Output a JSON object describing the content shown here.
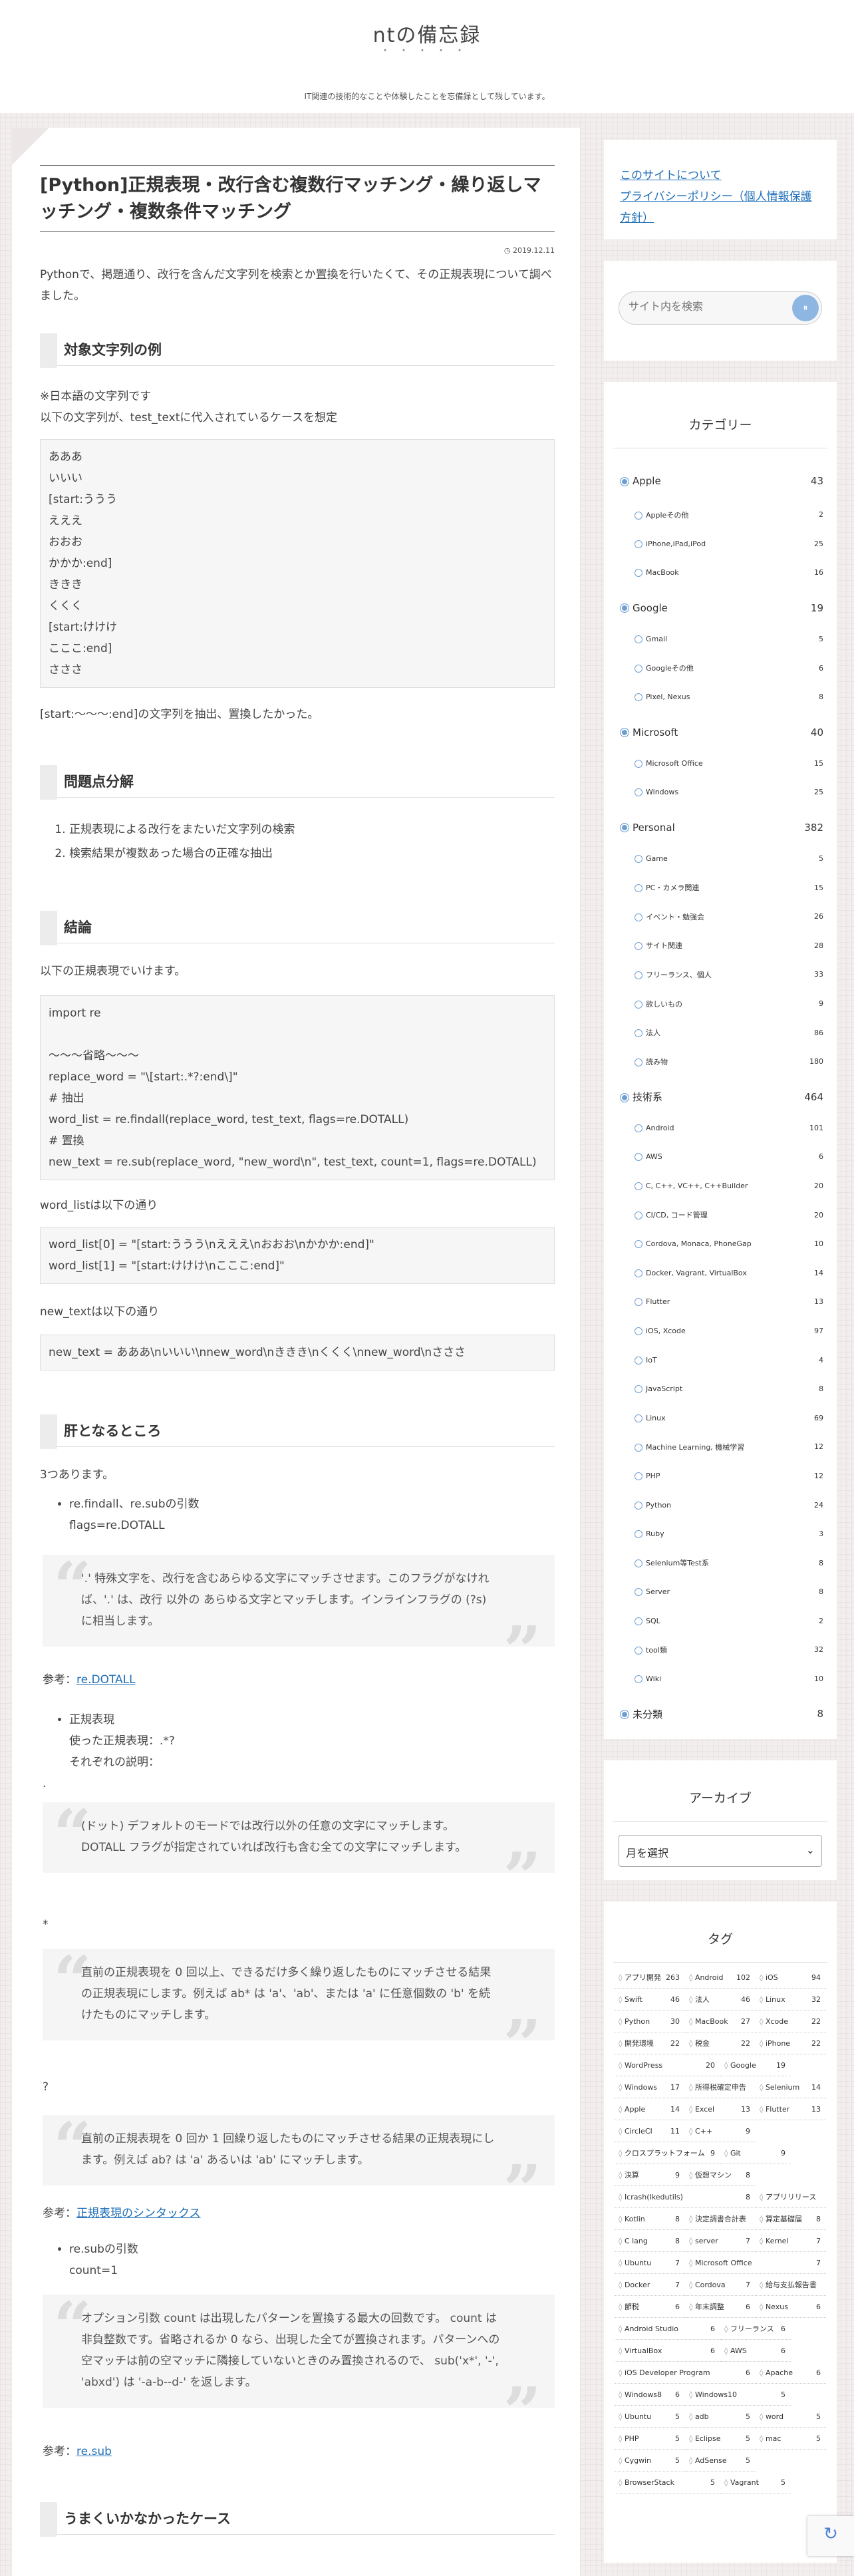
{
  "site": {
    "title": "ntの備忘録",
    "dots": "・・・・・",
    "tagline": "IT関連の技術的なことや体験したことを忘備録として残しています。"
  },
  "post": {
    "title": "[Python]正規表現・改行含む複数行マッチング・繰り返しマッチング・複数条件マッチング",
    "date": "2019.12.11",
    "intro": "Pythonで、掲題通り、改行を含んだ文字列を検索とか置換を行いたくて、その正規表現について調べました。",
    "sec1_title": "対象文字列の例",
    "sec1_p1": "※日本語の文字列です",
    "sec1_p2": "以下の文字列が、test_textに代入されているケースを想定",
    "sample_lines": [
      "あああ",
      "いいい",
      "[start:ううう",
      "えええ",
      "おおお",
      "かかか:end]",
      "ききき",
      "くくく",
      "[start:けけけ",
      "こここ:end]",
      "さささ"
    ],
    "sec1_after": "[start:〜〜〜:end]の文字列を抽出、置換したかった。",
    "sec2_title": "問題点分解",
    "problems": [
      "正規表現による改行をまたいだ文字列の検索",
      "検索結果が複数あった場合の正確な抽出"
    ],
    "sec3_title": "結論",
    "sec3_p": "以下の正規表現でいけます。",
    "code_lines": [
      "import re",
      "",
      "〜〜〜省略〜〜〜",
      "replace_word = \"\\[start:.*?:end\\]\"",
      "# 抽出",
      "word_list = re.findall(replace_word, test_text, flags=re.DOTALL)",
      "# 置換",
      "new_text = re.sub(replace_word, \"new_word\\n\", test_text, count=1, flags=re.DOTALL)"
    ],
    "wordlist_label": "word_listは以下の通り",
    "wordlist_lines": [
      "word_list[0] = \"[start:ううう\\nえええ\\nおおお\\nかかか:end]\"",
      "word_list[1] = \"[start:けけけ\\nこここ:end]\""
    ],
    "newtext_label": "new_textは以下の通り",
    "newtext_line": "new_text = あああ\\nいいい\\nnew_word\\nききき\\nくくく\\nnew_word\\nさささ",
    "sec4_title": "肝となるところ",
    "sec4_p": "3つあります。",
    "b1_l1": "re.findall、re.subの引数",
    "b1_l2": "flags=re.DOTALL",
    "q1": "'.' 特殊文字を、改行を含むあらゆる文字にマッチさせます。このフラグがなければ、'.' は、改行 以外の あらゆる文字とマッチします。インラインフラグの (?s) に相当します。",
    "ref_label": "参考：",
    "ref1_link": "re.DOTALL",
    "b2_l1": "正規表現",
    "b2_l2": "使った正規表現：.*?",
    "b2_l3": "それぞれの説明：",
    "dot_char": ".",
    "q2": "(ドット) デフォルトのモードでは改行以外の任意の文字にマッチします。 DOTALL フラグが指定されていれば改行も含む全ての文字にマッチします。",
    "star_char": "*",
    "q3": "直前の正規表現を 0 回以上、できるだけ多く繰り返したものにマッチさせる結果の正規表現にします。例えば ab* は 'a'、'ab'、または 'a' に任意個数の 'b' を続けたものにマッチします。",
    "q_char": "?",
    "q4": "直前の正規表現を 0 回か 1 回繰り返したものにマッチさせる結果の正規表現にします。例えば ab? は 'a' あるいは 'ab' にマッチします。",
    "ref2_link": "正規表現のシンタックス",
    "b3_l1": "re.subの引数",
    "b3_l2": "count=1",
    "q5": "オプション引数 count は出現したパターンを置換する最大の回数です。 count は非負整数です。省略されるか 0 なら、出現した全てが置換されます。パターンへの空マッチは前の空マッチに隣接していないときのみ置換されるので、 sub('x*', '-', 'abxd') は '-a-b--d-' を返します。",
    "ref3_link": "re.sub",
    "sec5_title": "うまくいかなかったケース"
  },
  "sidebar": {
    "links": [
      "このサイトについて",
      "プライバシーポリシー（個人情報保護方針）"
    ],
    "search_placeholder": "サイト内を検索",
    "category_title": "カテゴリー",
    "categories": [
      {
        "name": "Apple",
        "count": "43",
        "level": 1
      },
      {
        "name": "Appleその他",
        "count": "2",
        "level": 2
      },
      {
        "name": "iPhone,iPad,iPod",
        "count": "25",
        "level": 2
      },
      {
        "name": "MacBook",
        "count": "16",
        "level": 2
      },
      {
        "name": "Google",
        "count": "19",
        "level": 1
      },
      {
        "name": "Gmail",
        "count": "5",
        "level": 2
      },
      {
        "name": "Googleその他",
        "count": "6",
        "level": 2
      },
      {
        "name": "Pixel, Nexus",
        "count": "8",
        "level": 2
      },
      {
        "name": "Microsoft",
        "count": "40",
        "level": 1
      },
      {
        "name": "Microsoft Office",
        "count": "15",
        "level": 2
      },
      {
        "name": "Windows",
        "count": "25",
        "level": 2
      },
      {
        "name": "Personal",
        "count": "382",
        "level": 1
      },
      {
        "name": "Game",
        "count": "5",
        "level": 2
      },
      {
        "name": "PC・カメラ関連",
        "count": "15",
        "level": 2
      },
      {
        "name": "イベント・勉強会",
        "count": "26",
        "level": 2
      },
      {
        "name": "サイト関連",
        "count": "28",
        "level": 2
      },
      {
        "name": "フリーランス、個人",
        "count": "33",
        "level": 2
      },
      {
        "name": "欲しいもの",
        "count": "9",
        "level": 2
      },
      {
        "name": "法人",
        "count": "86",
        "level": 2
      },
      {
        "name": "読み物",
        "count": "180",
        "level": 2
      },
      {
        "name": "技術系",
        "count": "464",
        "level": 1
      },
      {
        "name": "Android",
        "count": "101",
        "level": 2
      },
      {
        "name": "AWS",
        "count": "6",
        "level": 2
      },
      {
        "name": "C, C++, VC++, C++Builder",
        "count": "20",
        "level": 2
      },
      {
        "name": "CI/CD, コード管理",
        "count": "20",
        "level": 2
      },
      {
        "name": "Cordova, Monaca, PhoneGap",
        "count": "10",
        "level": 2
      },
      {
        "name": "Docker, Vagrant, VirtualBox",
        "count": "14",
        "level": 2
      },
      {
        "name": "Flutter",
        "count": "13",
        "level": 2
      },
      {
        "name": "iOS, Xcode",
        "count": "97",
        "level": 2
      },
      {
        "name": "IoT",
        "count": "4",
        "level": 2
      },
      {
        "name": "JavaScript",
        "count": "8",
        "level": 2
      },
      {
        "name": "Linux",
        "count": "69",
        "level": 2
      },
      {
        "name": "Machine Learning, 機械学習",
        "count": "12",
        "level": 2
      },
      {
        "name": "PHP",
        "count": "12",
        "level": 2
      },
      {
        "name": "Python",
        "count": "24",
        "level": 2
      },
      {
        "name": "Ruby",
        "count": "3",
        "level": 2
      },
      {
        "name": "Selenium等Test系",
        "count": "8",
        "level": 2
      },
      {
        "name": "Server",
        "count": "8",
        "level": 2
      },
      {
        "name": "SQL",
        "count": "2",
        "level": 2
      },
      {
        "name": "tool類",
        "count": "32",
        "level": 2
      },
      {
        "name": "Wiki",
        "count": "10",
        "level": 2
      },
      {
        "name": "未分類",
        "count": "8",
        "level": 1
      }
    ],
    "archive_title": "アーカイブ",
    "archive_select": "月を選択",
    "tag_title": "タグ",
    "tags": [
      {
        "name": "アプリ開発",
        "count": "263"
      },
      {
        "name": "Android",
        "count": "102"
      },
      {
        "name": "iOS",
        "count": "94"
      },
      {
        "name": "Swift",
        "count": "46"
      },
      {
        "name": "法人",
        "count": "46"
      },
      {
        "name": "Linux",
        "count": "32"
      },
      {
        "name": "Python",
        "count": "30"
      },
      {
        "name": "MacBook",
        "count": "27"
      },
      {
        "name": "Xcode",
        "count": "22"
      },
      {
        "name": "開発環境",
        "count": "22"
      },
      {
        "name": "税金",
        "count": "22"
      },
      {
        "name": "iPhone",
        "count": "22"
      },
      {
        "name": "WordPress",
        "count": "20"
      },
      {
        "name": "Google",
        "count": "19"
      },
      {
        "name": "Windows",
        "count": "17"
      },
      {
        "name": "所得税確定申告",
        "count": "16"
      },
      {
        "name": "Selenium",
        "count": "14"
      },
      {
        "name": "Apple",
        "count": "14"
      },
      {
        "name": "Excel",
        "count": "13"
      },
      {
        "name": "Flutter",
        "count": "13"
      },
      {
        "name": "CircleCI",
        "count": "11"
      },
      {
        "name": "C++",
        "count": "9"
      },
      {
        "name": "クロスプラットフォーム",
        "count": "9"
      },
      {
        "name": "Git",
        "count": "9"
      },
      {
        "name": "決算",
        "count": "9"
      },
      {
        "name": "仮想マシン",
        "count": "8"
      },
      {
        "name": "Icrash(Ikedutils)",
        "count": "8"
      },
      {
        "name": "アプリリリース",
        "count": "8"
      },
      {
        "name": "Kotlin",
        "count": "8"
      },
      {
        "name": "決定調書合計表",
        "count": "8"
      },
      {
        "name": "算定基礎届",
        "count": "8"
      },
      {
        "name": "C lang",
        "count": "8"
      },
      {
        "name": "server",
        "count": "7"
      },
      {
        "name": "Kernel",
        "count": "7"
      },
      {
        "name": "Ubuntu",
        "count": "7"
      },
      {
        "name": "Microsoft Office",
        "count": "7"
      },
      {
        "name": "Docker",
        "count": "7"
      },
      {
        "name": "Cordova",
        "count": "7"
      },
      {
        "name": "給与支払報告書",
        "count": "7"
      },
      {
        "name": "節税",
        "count": "6"
      },
      {
        "name": "年末調整",
        "count": "6"
      },
      {
        "name": "Nexus",
        "count": "6"
      },
      {
        "name": "Android Studio",
        "count": "6"
      },
      {
        "name": "フリーランス",
        "count": "6"
      },
      {
        "name": "VirtualBox",
        "count": "6"
      },
      {
        "name": "AWS",
        "count": "6"
      },
      {
        "name": "iOS Developer Program",
        "count": "6"
      },
      {
        "name": "Apache",
        "count": "6"
      },
      {
        "name": "Windows8",
        "count": "6"
      },
      {
        "name": "Windows10",
        "count": "5"
      },
      {
        "name": "Ubuntu",
        "count": "5"
      },
      {
        "name": "adb",
        "count": "5"
      },
      {
        "name": "word",
        "count": "5"
      },
      {
        "name": "PHP",
        "count": "5"
      },
      {
        "name": "Eclipse",
        "count": "5"
      },
      {
        "name": "mac",
        "count": "5"
      },
      {
        "name": "Cygwin",
        "count": "5"
      },
      {
        "name": "AdSense",
        "count": "5"
      },
      {
        "name": "BrowserStack",
        "count": "5"
      },
      {
        "name": "Vagrant",
        "count": "5"
      }
    ]
  }
}
